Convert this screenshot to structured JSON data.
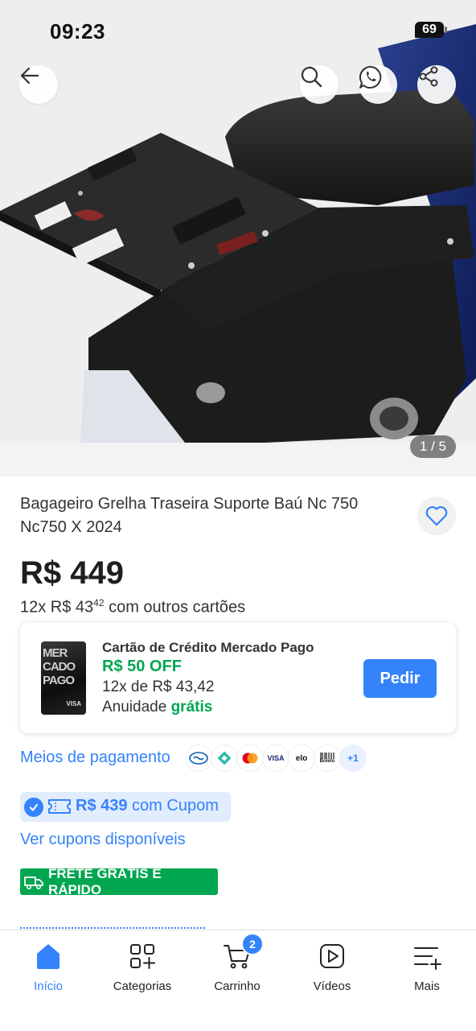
{
  "status_bar": {
    "time": "09:23",
    "battery": "69"
  },
  "gallery": {
    "counter": "1 / 5"
  },
  "product": {
    "title": "Bagageiro Grelha Traseira Suporte Baú Nc 750 Nc750 X 2024",
    "price": "R$ 449",
    "installments_prefix": "12x R$ 43",
    "installments_cents": "42",
    "installments_suffix": " com outros cartões"
  },
  "mp_offer": {
    "card_text": "MER CADO PAGO",
    "card_brand": "VISA",
    "title": "Cartão de Crédito Mercado Pago",
    "discount": "R$ 50 OFF",
    "installments": "12x de R$ 43,42",
    "annual_label": "Anuidade ",
    "annual_value": "grátis",
    "button": "Pedir"
  },
  "payment": {
    "label": "Meios de pagamento",
    "methods": [
      "mercado-pago",
      "pix",
      "mastercard",
      "visa",
      "elo",
      "boleto"
    ],
    "visa_text": "VISA",
    "elo_text": "elo",
    "boleto_text": "Boleto",
    "more": "+1"
  },
  "coupon": {
    "price": "R$ 439",
    "suffix": " com Cupom",
    "link": "Ver cupons disponíveis"
  },
  "shipping": {
    "badge": "FRETE GRÁTIS E RÁPIDO"
  },
  "tabbar": {
    "items": [
      {
        "label": "Início",
        "active": true
      },
      {
        "label": "Categorias"
      },
      {
        "label": "Carrinho",
        "badge": "2"
      },
      {
        "label": "Vídeos"
      },
      {
        "label": "Mais"
      }
    ]
  },
  "colors": {
    "accent": "#3483fa",
    "green": "#00a650"
  }
}
